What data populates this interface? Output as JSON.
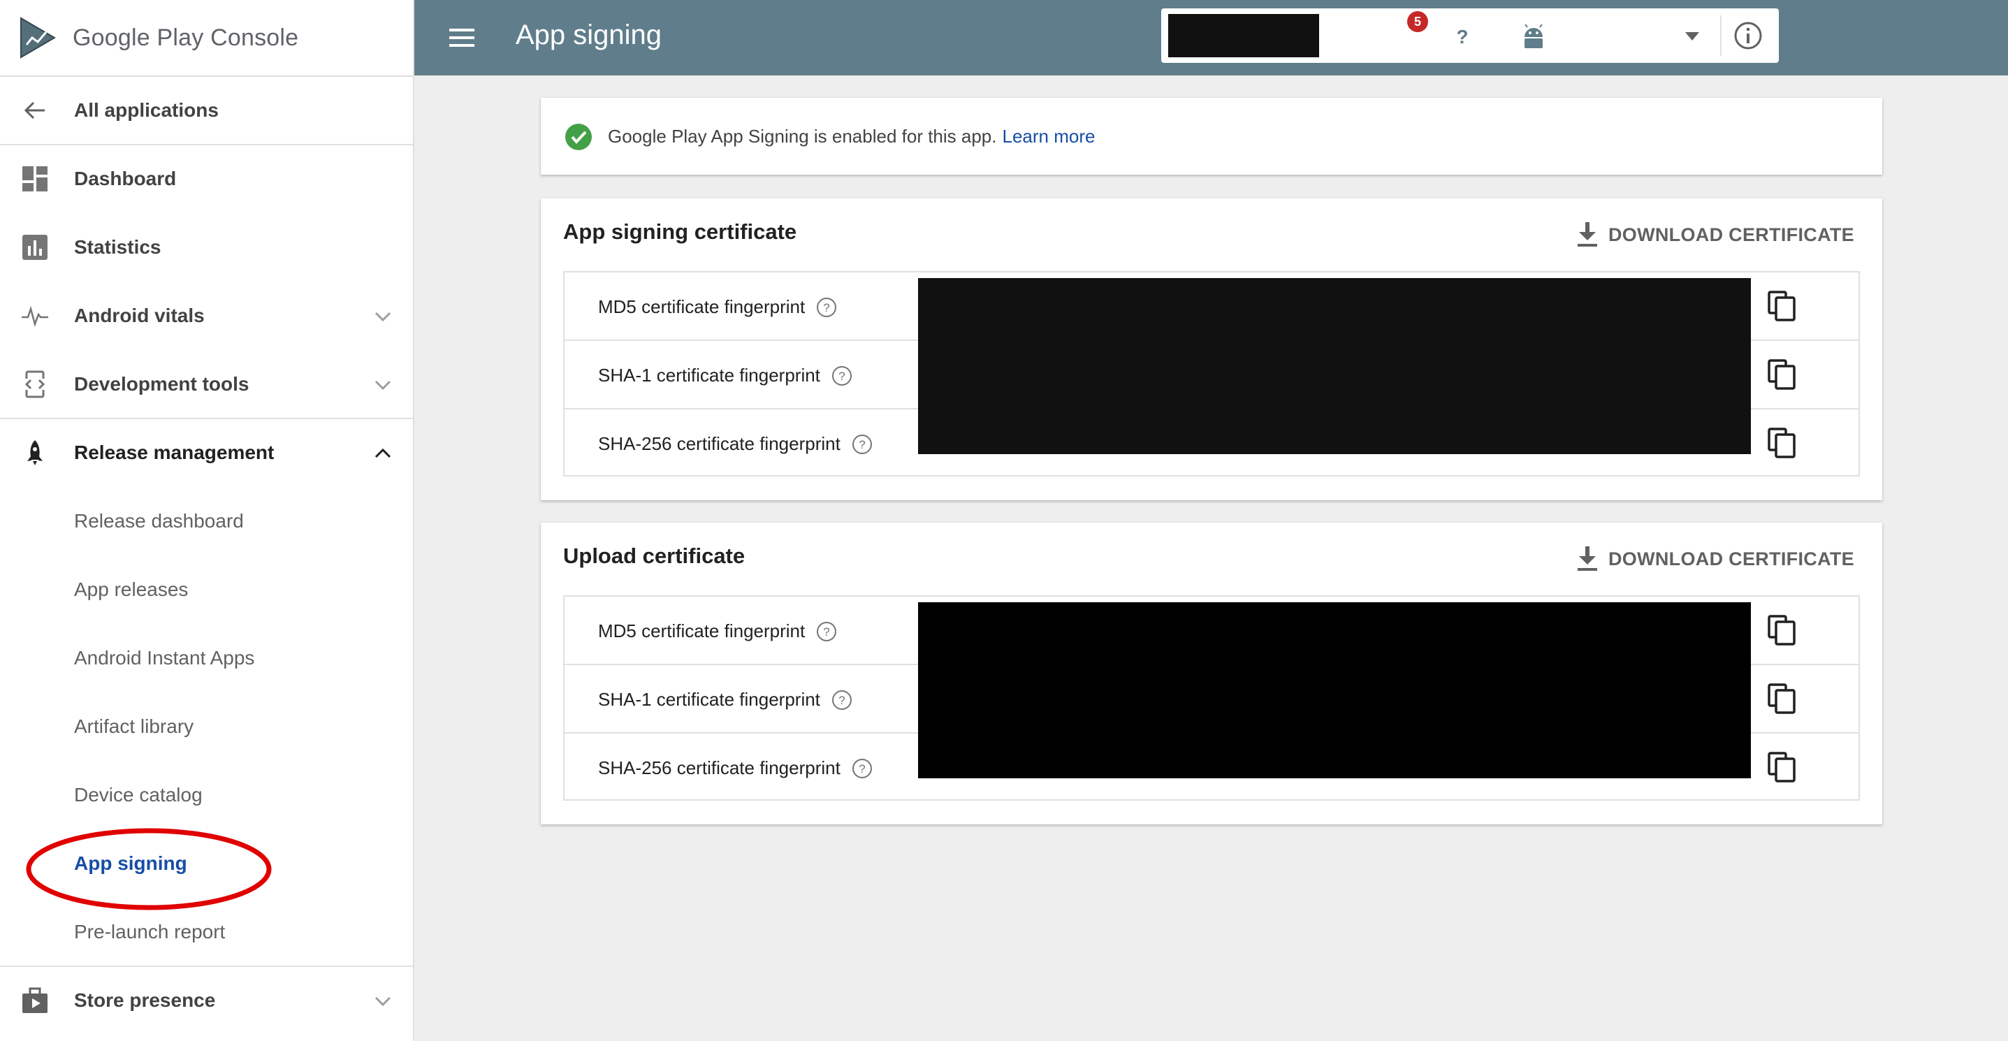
{
  "brand": {
    "name": "Google Play",
    "product": "Console"
  },
  "topbar": {
    "title": "App signing",
    "notification_count": "5"
  },
  "nav": {
    "all_applications": "All applications",
    "dashboard": "Dashboard",
    "statistics": "Statistics",
    "android_vitals": "Android vitals",
    "development_tools": "Development tools",
    "release_management": "Release management",
    "release_sub": [
      "Release dashboard",
      "App releases",
      "Android Instant Apps",
      "Artifact library",
      "Device catalog",
      "App signing",
      "Pre-launch report"
    ],
    "store_presence": "Store presence",
    "active_item": "App signing"
  },
  "notice": {
    "text": "Google Play App Signing is enabled for this app.",
    "link": "Learn more"
  },
  "certificates": [
    {
      "title": "App signing certificate",
      "download_label": "DOWNLOAD CERTIFICATE",
      "fingerprints": [
        "MD5 certificate fingerprint",
        "SHA-1 certificate fingerprint",
        "SHA-256 certificate fingerprint"
      ]
    },
    {
      "title": "Upload certificate",
      "download_label": "DOWNLOAD CERTIFICATE",
      "fingerprints": [
        "MD5 certificate fingerprint",
        "SHA-1 certificate fingerprint",
        "SHA-256 certificate fingerprint"
      ]
    }
  ],
  "colors": {
    "topbar": "#607d8b",
    "active_link": "#174ea6",
    "success": "#43a047",
    "annotation": "#e00000",
    "badge": "#c62828"
  },
  "icons": {
    "menu": "hamburger-icon",
    "info": "info-icon",
    "notifications": "bell-icon",
    "help": "help-icon",
    "copy": "copy-icon",
    "download": "download-icon"
  }
}
